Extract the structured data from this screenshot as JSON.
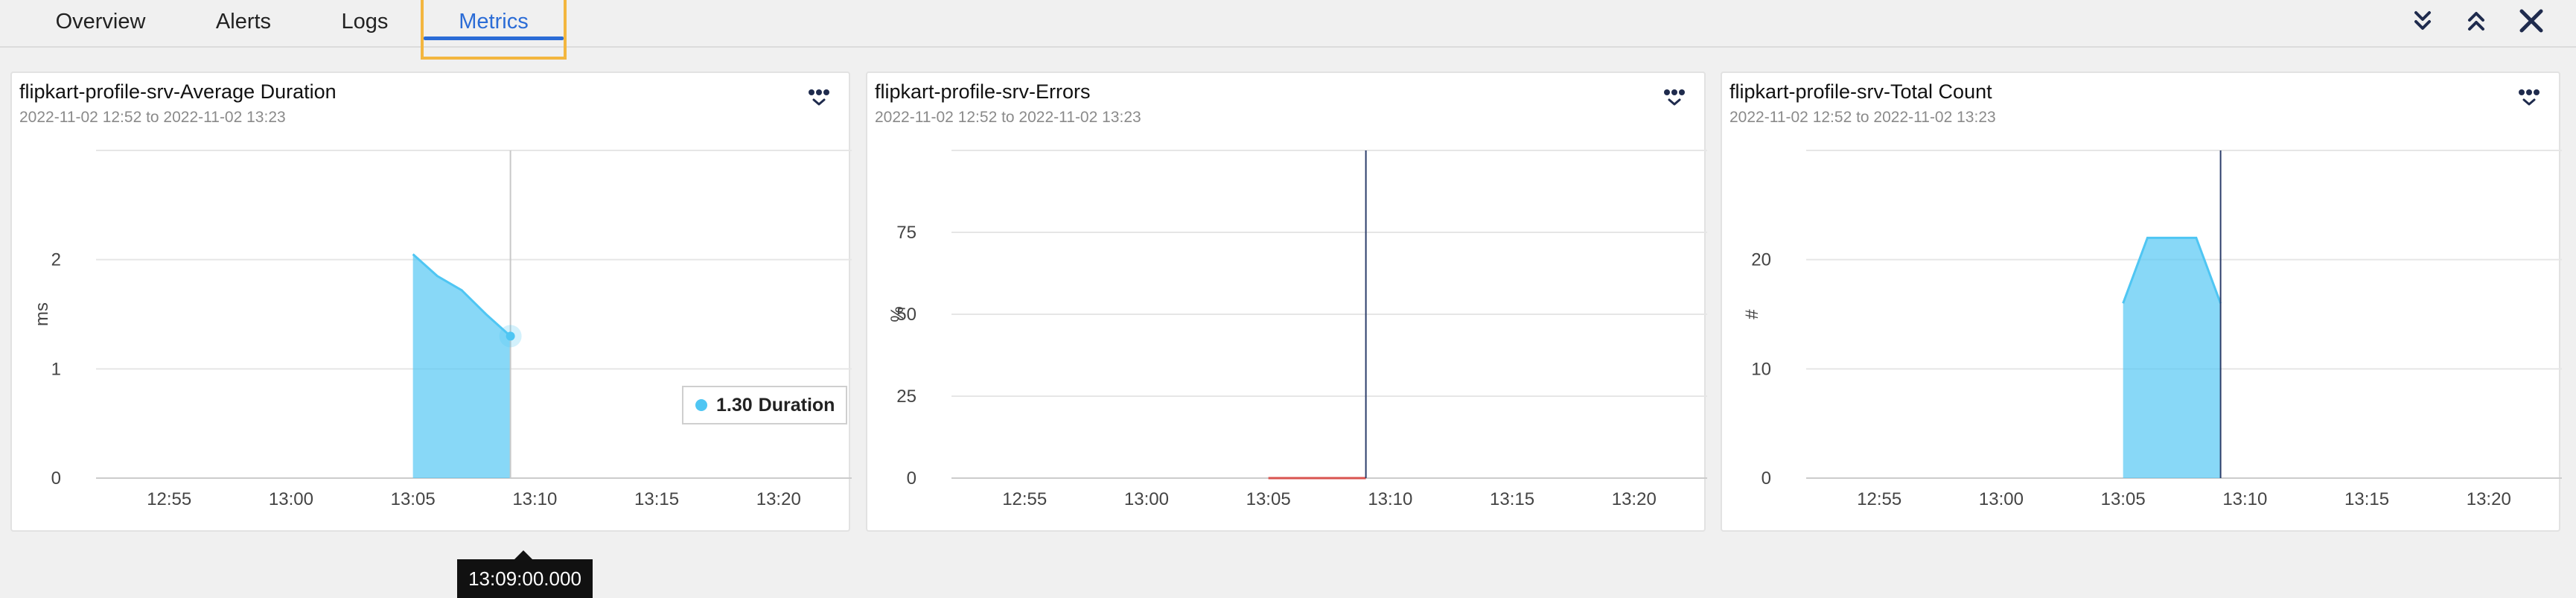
{
  "tabs": [
    {
      "label": "Overview",
      "active": false
    },
    {
      "label": "Alerts",
      "active": false
    },
    {
      "label": "Logs",
      "active": false
    },
    {
      "label": "Metrics",
      "active": true
    }
  ],
  "toolbar_icons": [
    "expand-all-icon",
    "collapse-all-icon",
    "close-icon"
  ],
  "colors": {
    "accent": "#2b6cd6",
    "focus": "#f3b63f",
    "series": "#4fc6f3",
    "error_series": "#d9534f",
    "cursor_line": "#2c3e6b"
  },
  "panels": [
    {
      "title": "flipkart-profile-srv-Average Duration",
      "subtitle": "2022-11-02 12:52 to 2022-11-02 13:23",
      "ylabel": "ms",
      "legend_value": "1.30",
      "legend_label": "Duration",
      "tooltip": "13:09:00.000"
    },
    {
      "title": "flipkart-profile-srv-Errors",
      "subtitle": "2022-11-02 12:52 to 2022-11-02 13:23",
      "ylabel": "%"
    },
    {
      "title": "flipkart-profile-srv-Total Count",
      "subtitle": "2022-11-02 12:52 to 2022-11-02 13:23",
      "ylabel": "#"
    }
  ],
  "chart_data": [
    {
      "type": "area",
      "title": "flipkart-profile-srv-Average Duration",
      "ylabel": "ms",
      "x": [
        "13:05",
        "13:06",
        "13:07",
        "13:08",
        "13:09"
      ],
      "series": [
        {
          "name": "Duration",
          "values": [
            2.05,
            1.85,
            1.72,
            1.5,
            1.3
          ]
        }
      ],
      "xticks": [
        "12:55",
        "13:00",
        "13:05",
        "13:10",
        "13:15",
        "13:20"
      ],
      "yticks": [
        0,
        1,
        2
      ],
      "xlim": [
        "12:52",
        "13:23"
      ],
      "ylim": [
        0,
        3
      ],
      "cursor": "13:09",
      "grid": true
    },
    {
      "type": "line",
      "title": "flipkart-profile-srv-Errors",
      "ylabel": "%",
      "x": [
        "13:05",
        "13:09"
      ],
      "series": [
        {
          "values": [
            0,
            0
          ]
        }
      ],
      "xticks": [
        "12:55",
        "13:00",
        "13:05",
        "13:10",
        "13:15",
        "13:20"
      ],
      "yticks": [
        0,
        25,
        50,
        75
      ],
      "xlim": [
        "12:52",
        "13:23"
      ],
      "ylim": [
        0,
        100
      ],
      "cursor": "13:09",
      "grid": true
    },
    {
      "type": "area",
      "title": "flipkart-profile-srv-Total Count",
      "ylabel": "#",
      "x": [
        "13:05",
        "13:06",
        "13:07",
        "13:08",
        "13:09"
      ],
      "series": [
        {
          "values": [
            16,
            22,
            22,
            22,
            16
          ]
        }
      ],
      "xticks": [
        "12:55",
        "13:00",
        "13:05",
        "13:10",
        "13:15",
        "13:20"
      ],
      "yticks": [
        0,
        10,
        20
      ],
      "xlim": [
        "12:52",
        "13:23"
      ],
      "ylim": [
        0,
        30
      ],
      "cursor": "13:09",
      "grid": true
    }
  ]
}
